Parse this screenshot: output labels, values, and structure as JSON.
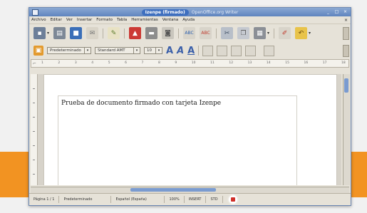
{
  "window": {
    "document_title": "Izenpe (firmado)",
    "app_title": "OpenOffice.org Writer"
  },
  "menu": [
    "Archivo",
    "Editar",
    "Ver",
    "Insertar",
    "Formato",
    "Tabla",
    "Herramientas",
    "Ventana",
    "Ayuda"
  ],
  "toolbar": {
    "paragraph_style": "Predeterminado",
    "font_name": "Standard AMT",
    "font_size": "10"
  },
  "ruler_ticks": [
    "1",
    "2",
    "3",
    "4",
    "5",
    "6",
    "7",
    "8",
    "9",
    "10",
    "11",
    "12",
    "13",
    "14",
    "15",
    "16",
    "17",
    "18"
  ],
  "document": {
    "text": "Prueba de documento firmado con tarjeta Izenpe"
  },
  "status": {
    "page": "Página 1 / 1",
    "style": "Predeterminado",
    "language": "Español (España)",
    "zoom": "100%",
    "mode": "INSERT",
    "selection": "STD"
  },
  "colors": {
    "accent_band": "#f29322",
    "title_highlight": "#3e6fbf",
    "signature_icon": "#d0302a"
  }
}
